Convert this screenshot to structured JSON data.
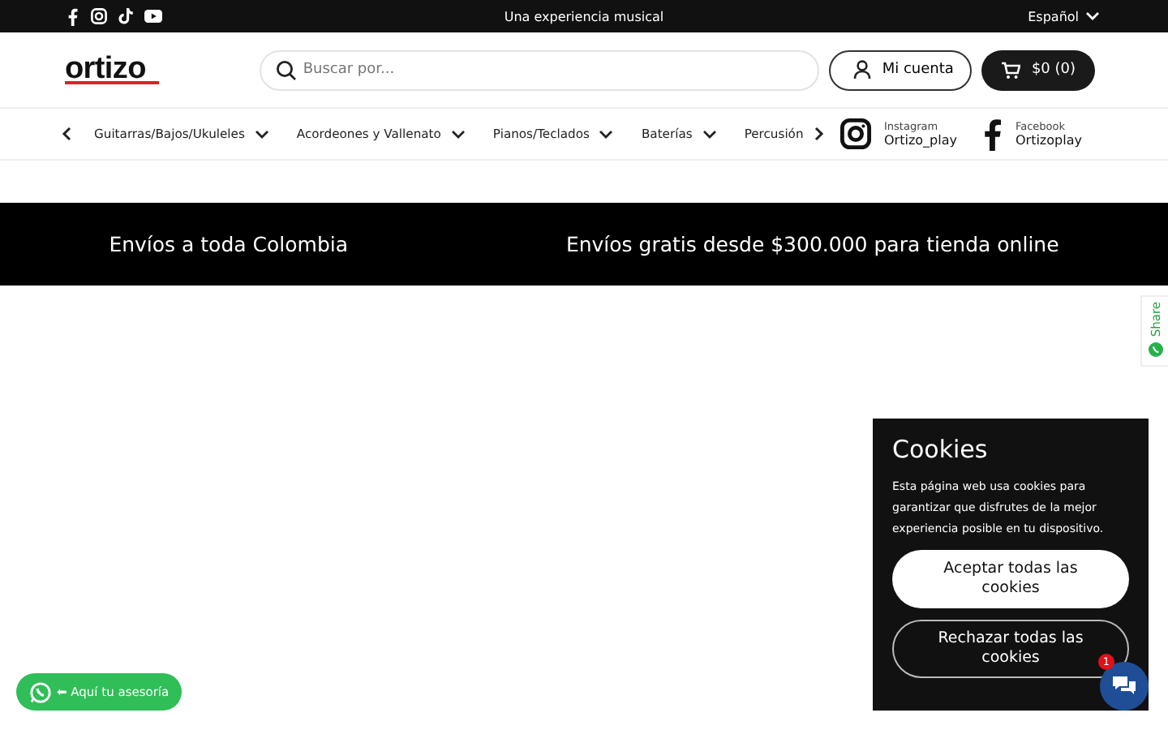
{
  "top_bar": {
    "social": [
      {
        "kind": "facebook"
      },
      {
        "kind": "instagram"
      },
      {
        "kind": "tiktok"
      },
      {
        "kind": "youtube"
      }
    ],
    "tagline": "Una experiencia musical",
    "language": "Español"
  },
  "header": {
    "logo": "ortizo",
    "search": {
      "placeholder": "Buscar por..."
    },
    "account": "Mi cuenta",
    "cart": "$0 (0)"
  },
  "nav": {
    "items": [
      "Guitarras/Bajos/Ukuleles",
      "Acordeones y Vallenato",
      "Pianos/Teclados",
      "Baterías",
      "Percusión"
    ],
    "social_links": [
      {
        "kind": "instagram",
        "network": "Instagram",
        "handle": "Ortizo_play"
      },
      {
        "kind": "facebook",
        "network": "Facebook",
        "handle": "Ortizoplay"
      }
    ]
  },
  "banner": [
    "Envíos a toda Colombia",
    "Envíos gratis desde $300.000 para tienda online"
  ],
  "share_tab": "Share",
  "cookies": {
    "title": "Cookies",
    "text": "Esta página web usa cookies para garantizar que disfrutes de la mejor experiencia posible en tu dispositivo.",
    "accept": "Aceptar todas las cookies",
    "reject": "Rechazar todas las cookies"
  },
  "whatsapp_button": "⬅ Aquí tu asesoría",
  "chat": {
    "badge": "1"
  }
}
